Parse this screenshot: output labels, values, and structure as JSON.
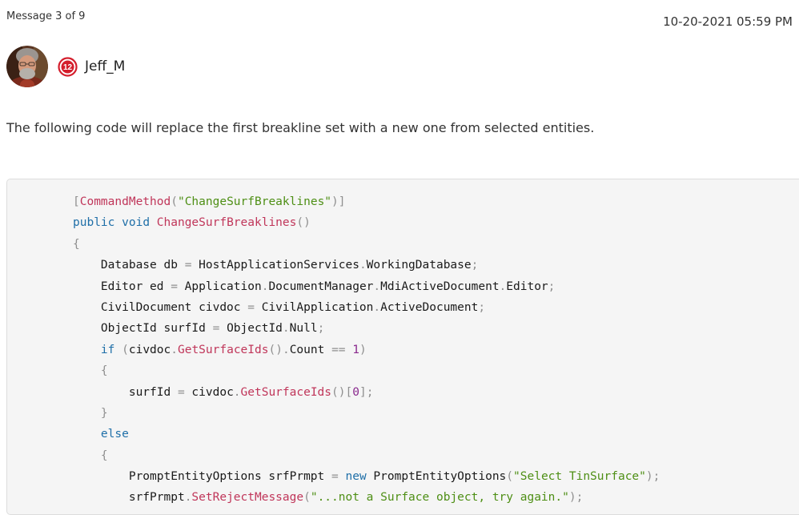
{
  "message": {
    "counter": "Message 3 of 9",
    "timestamp": "10-20-2021 05:59 PM"
  },
  "author": {
    "name": "Jeff_M",
    "rank_badge": "12"
  },
  "post": {
    "body": "The following code will replace the first breakline set with a new one from selected entities."
  },
  "colors": {
    "keyword": "#1f6fa8",
    "function": "#c0365a",
    "string": "#4e8f15",
    "number": "#8a2a8e",
    "punctuation": "#8f8f8f",
    "badge": "#d41e2c"
  },
  "code": {
    "lines": [
      [
        [
          "punc",
          "["
        ],
        [
          "fn",
          "CommandMethod"
        ],
        [
          "punc",
          "("
        ],
        [
          "str",
          "\"ChangeSurfBreaklines\""
        ],
        [
          "punc",
          ")]"
        ]
      ],
      [
        [
          "kw",
          "public"
        ],
        [
          "id",
          " "
        ],
        [
          "kw",
          "void"
        ],
        [
          "id",
          " "
        ],
        [
          "fn",
          "ChangeSurfBreaklines"
        ],
        [
          "punc",
          "()"
        ]
      ],
      [
        [
          "punc",
          "{"
        ]
      ],
      [
        [
          "id",
          "    Database db "
        ],
        [
          "punc",
          "="
        ],
        [
          "id",
          " HostApplicationServices"
        ],
        [
          "punc",
          "."
        ],
        [
          "id",
          "WorkingDatabase"
        ],
        [
          "punc",
          ";"
        ]
      ],
      [
        [
          "id",
          "    Editor ed "
        ],
        [
          "punc",
          "="
        ],
        [
          "id",
          " Application"
        ],
        [
          "punc",
          "."
        ],
        [
          "id",
          "DocumentManager"
        ],
        [
          "punc",
          "."
        ],
        [
          "id",
          "MdiActiveDocument"
        ],
        [
          "punc",
          "."
        ],
        [
          "id",
          "Editor"
        ],
        [
          "punc",
          ";"
        ]
      ],
      [
        [
          "id",
          "    CivilDocument civdoc "
        ],
        [
          "punc",
          "="
        ],
        [
          "id",
          " CivilApplication"
        ],
        [
          "punc",
          "."
        ],
        [
          "id",
          "ActiveDocument"
        ],
        [
          "punc",
          ";"
        ]
      ],
      [
        [
          "id",
          "    ObjectId surfId "
        ],
        [
          "punc",
          "="
        ],
        [
          "id",
          " ObjectId"
        ],
        [
          "punc",
          "."
        ],
        [
          "id",
          "Null"
        ],
        [
          "punc",
          ";"
        ]
      ],
      [
        [
          "id",
          "    "
        ],
        [
          "kw",
          "if"
        ],
        [
          "id",
          " "
        ],
        [
          "punc",
          "("
        ],
        [
          "id",
          "civdoc"
        ],
        [
          "punc",
          "."
        ],
        [
          "fn",
          "GetSurfaceIds"
        ],
        [
          "punc",
          "()."
        ],
        [
          "id",
          "Count "
        ],
        [
          "punc",
          "=="
        ],
        [
          "id",
          " "
        ],
        [
          "num",
          "1"
        ],
        [
          "punc",
          ")"
        ]
      ],
      [
        [
          "id",
          "    "
        ],
        [
          "punc",
          "{"
        ]
      ],
      [
        [
          "id",
          "        surfId "
        ],
        [
          "punc",
          "="
        ],
        [
          "id",
          " civdoc"
        ],
        [
          "punc",
          "."
        ],
        [
          "fn",
          "GetSurfaceIds"
        ],
        [
          "punc",
          "()["
        ],
        [
          "num",
          "0"
        ],
        [
          "punc",
          "];"
        ]
      ],
      [
        [
          "id",
          "    "
        ],
        [
          "punc",
          "}"
        ]
      ],
      [
        [
          "id",
          "    "
        ],
        [
          "kw",
          "else"
        ]
      ],
      [
        [
          "id",
          "    "
        ],
        [
          "punc",
          "{"
        ]
      ],
      [
        [
          "id",
          "        PromptEntityOptions srfPrmpt "
        ],
        [
          "punc",
          "="
        ],
        [
          "id",
          " "
        ],
        [
          "kw",
          "new"
        ],
        [
          "id",
          " PromptEntityOptions"
        ],
        [
          "punc",
          "("
        ],
        [
          "str",
          "\"Select TinSurface\""
        ],
        [
          "punc",
          ");"
        ]
      ],
      [
        [
          "id",
          "        srfPrmpt"
        ],
        [
          "punc",
          "."
        ],
        [
          "fn",
          "SetRejectMessage"
        ],
        [
          "punc",
          "("
        ],
        [
          "str",
          "\"...not a Surface object, try again.\""
        ],
        [
          "punc",
          ");"
        ]
      ]
    ]
  }
}
